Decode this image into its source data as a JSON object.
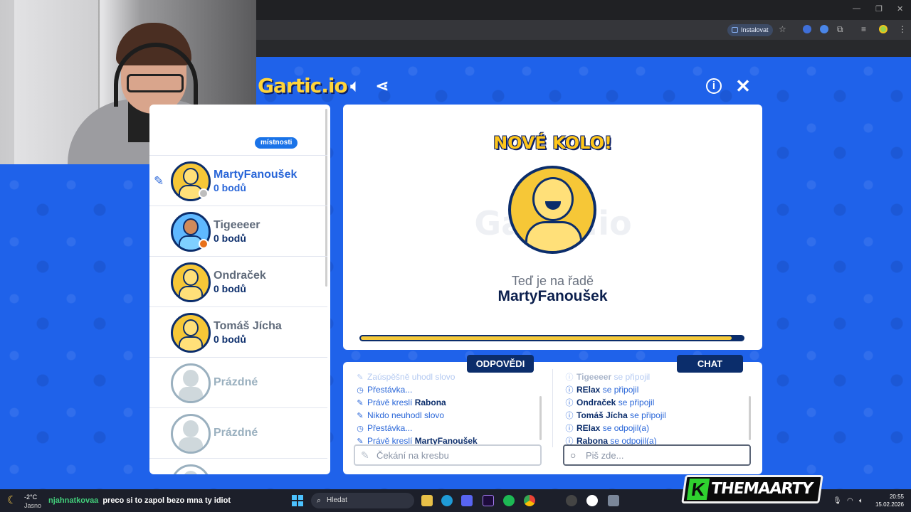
{
  "browser": {
    "install_label": "Instalovat"
  },
  "header": {
    "logo_text": "Gartic.io"
  },
  "player_panel": {
    "badge": "místnosti",
    "players": [
      {
        "name": "MartyFanoušek",
        "score": "0 bodů",
        "drawing": true,
        "dot_color": "#bdbdbd"
      },
      {
        "name": "Tigeeeer",
        "score": "0 bodů",
        "drawing": false,
        "dot_color": "#e8711a"
      },
      {
        "name": "Ondraček",
        "score": "0 bodů",
        "drawing": false
      },
      {
        "name": "Tomáš Jícha",
        "score": "0 bodů",
        "drawing": false
      }
    ],
    "empty_slots": [
      "Prázdné",
      "Prázdné"
    ]
  },
  "board": {
    "new_round": "NOVÉ KOLO!",
    "watermark": "Gartic.io",
    "turn_label": "Teď je na řadě",
    "turn_player": "MartyFanoušek",
    "progress": 0.97
  },
  "answers": {
    "tab_label": "ODPOVĚDI",
    "messages": [
      {
        "icon": "pencil",
        "pre": "Zaúspěšně uhodl slovo",
        "bold": "",
        "post": ""
      },
      {
        "icon": "clock",
        "pre": "Přestávka...",
        "bold": "",
        "post": ""
      },
      {
        "icon": "pencil",
        "pre": "Právě kreslí ",
        "bold": "Rabona",
        "post": ""
      },
      {
        "icon": "pencil",
        "pre": "Nikdo neuhodl slovo",
        "bold": "",
        "post": ""
      },
      {
        "icon": "clock",
        "pre": "Přestávka...",
        "bold": "",
        "post": ""
      },
      {
        "icon": "pencil",
        "pre": "Právě kreslí ",
        "bold": "MartyFanoušek",
        "post": ""
      }
    ],
    "input_placeholder": "Čekání na kresbu"
  },
  "chat": {
    "tab_label": "CHAT",
    "messages": [
      {
        "bold": "Tigeeeer",
        "post": " se připojil"
      },
      {
        "bold": "RElax",
        "post": " se připojil"
      },
      {
        "bold": "Ondraček",
        "post": " se připojil"
      },
      {
        "bold": "Tomáš Jícha",
        "post": " se připojil"
      },
      {
        "bold": "RElax",
        "post": " se odpojil(a)"
      },
      {
        "bold": "Rabona",
        "post": " se odpojil(a)"
      }
    ],
    "input_placeholder": "Piš zde..."
  },
  "stream_overlay": {
    "chat_user": "njahnatkovaa",
    "chat_text": "preco si to zapol bezo mna ty idiot",
    "brand": "THEMAARTY",
    "brand_letter": "K"
  },
  "taskbar": {
    "temperature": "-2°C",
    "weather": "Jasno",
    "search_label": "Hledat",
    "time": "20:55",
    "date": "15.02.2026"
  },
  "colors": {
    "background": "#1f62ea",
    "navy": "#0b2d6b",
    "accent_blue": "#2966d8",
    "yellow": "#f4c93a"
  }
}
